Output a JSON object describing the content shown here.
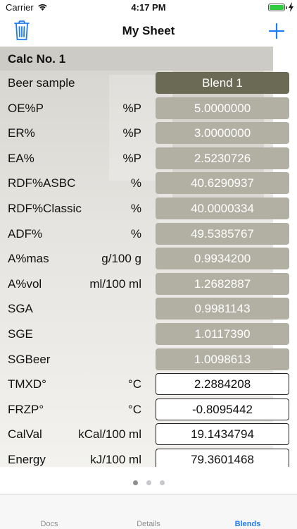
{
  "status_bar": {
    "carrier": "Carrier",
    "time": "4:17 PM",
    "battery_level": 1.0
  },
  "nav": {
    "title": "My Sheet",
    "accent_color": "#1d7cf2"
  },
  "sheet": {
    "calc_title": "Calc No. 1",
    "rows": [
      {
        "label": "Beer sample",
        "unit": "",
        "value": "Blend 1",
        "kind": "sample"
      },
      {
        "label": "OE%P",
        "unit": "%P",
        "value": "5.0000000",
        "kind": "computed"
      },
      {
        "label": "ER%",
        "unit": "%P",
        "value": "3.0000000",
        "kind": "computed"
      },
      {
        "label": "EA%",
        "unit": "%P",
        "value": "2.5230726",
        "kind": "computed"
      },
      {
        "label": "RDF%ASBC",
        "unit": "%",
        "value": "40.6290937",
        "kind": "computed"
      },
      {
        "label": "RDF%Classic",
        "unit": "%",
        "value": "40.0000334",
        "kind": "computed"
      },
      {
        "label": "ADF%",
        "unit": "%",
        "value": "49.5385767",
        "kind": "computed"
      },
      {
        "label": "A%mas",
        "unit": "g/100 g",
        "value": "0.9934200",
        "kind": "computed"
      },
      {
        "label": "A%vol",
        "unit": "ml/100 ml",
        "value": "1.2682887",
        "kind": "computed"
      },
      {
        "label": "SGA",
        "unit": "",
        "value": "0.9981143",
        "kind": "computed"
      },
      {
        "label": "SGE",
        "unit": "",
        "value": "1.0117390",
        "kind": "computed"
      },
      {
        "label": "SGBeer",
        "unit": "",
        "value": "1.0098613",
        "kind": "computed"
      },
      {
        "label": "TMXD°",
        "unit": "°C",
        "value": "2.2884208",
        "kind": "input"
      },
      {
        "label": "FRZP°",
        "unit": "°C",
        "value": "-0.8095442",
        "kind": "input"
      },
      {
        "label": "CalVal",
        "unit": "kCal/100 ml",
        "value": "19.1434794",
        "kind": "input"
      },
      {
        "label": "Energy",
        "unit": "kJ/100 ml",
        "value": "79.3601468",
        "kind": "input"
      }
    ]
  },
  "pager": {
    "pages": 3,
    "current": 1
  },
  "tabs": [
    {
      "label": "Docs",
      "active": false
    },
    {
      "label": "Details",
      "active": false
    },
    {
      "label": "Blends",
      "active": true
    }
  ]
}
